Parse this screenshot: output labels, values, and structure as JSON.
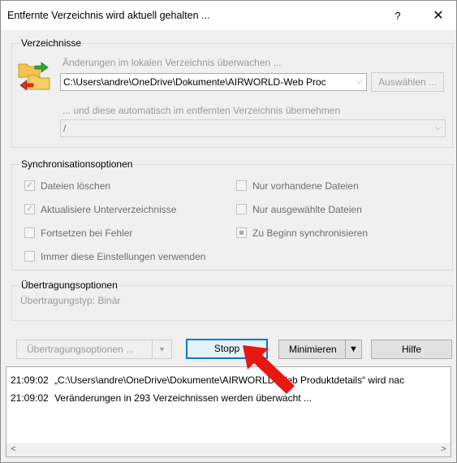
{
  "window": {
    "title": "Entfernte Verzeichnis wird aktuell gehalten ...",
    "help_glyph": "?",
    "close_glyph": "✕"
  },
  "directories": {
    "group_label": "Verzeichnisse",
    "local_watch_label": "Änderungen im lokalen Verzeichnis überwachen ...",
    "local_path": "C:\\Users\\andre\\OneDrive\\Dokumente\\AIRWORLD-Web Proc",
    "choose_button": "Auswählen ...",
    "remote_apply_label": "... und diese automatisch im entfernten Verzeichnis übernehmen",
    "remote_path": "/"
  },
  "sync_options": {
    "group_label": "Synchronisationsoptionen",
    "delete_files": "Dateien löschen",
    "update_subdirs": "Aktualisiere Unterverzeichnisse",
    "continue_on_error": "Fortsetzen bei Fehler",
    "existing_only": "Nur vorhandene Dateien",
    "selected_only": "Nur ausgewählte Dateien",
    "sync_at_start": "Zu Beginn synchronisieren",
    "always_use": "Immer diese Einstellungen verwenden"
  },
  "transfer": {
    "group_label": "Übertragungsoptionen",
    "type_text": "Übertragungstyp: Binär"
  },
  "buttons": {
    "transfer_options": "Übertragungsoptionen ...",
    "stop": "Stopp",
    "minimize": "Minimieren",
    "help": "Hilfe"
  },
  "log": {
    "lines": [
      {
        "time": "21:09:02",
        "text": "„C:\\Users\\andre\\OneDrive\\Dokumente\\AIRWORLD-Web Produktdetails“ wird nac"
      },
      {
        "time": "21:09:02",
        "text": "Veränderungen in 293 Verzeichnissen werden überwacht ..."
      }
    ]
  },
  "icons": {
    "sync_folder": "sync-folder-icon",
    "red_arrow": "red-arrow-annotation-icon"
  },
  "colors": {
    "accent": "#0078d7",
    "annotation": "#e8170f",
    "folder": "#f2c34e"
  }
}
